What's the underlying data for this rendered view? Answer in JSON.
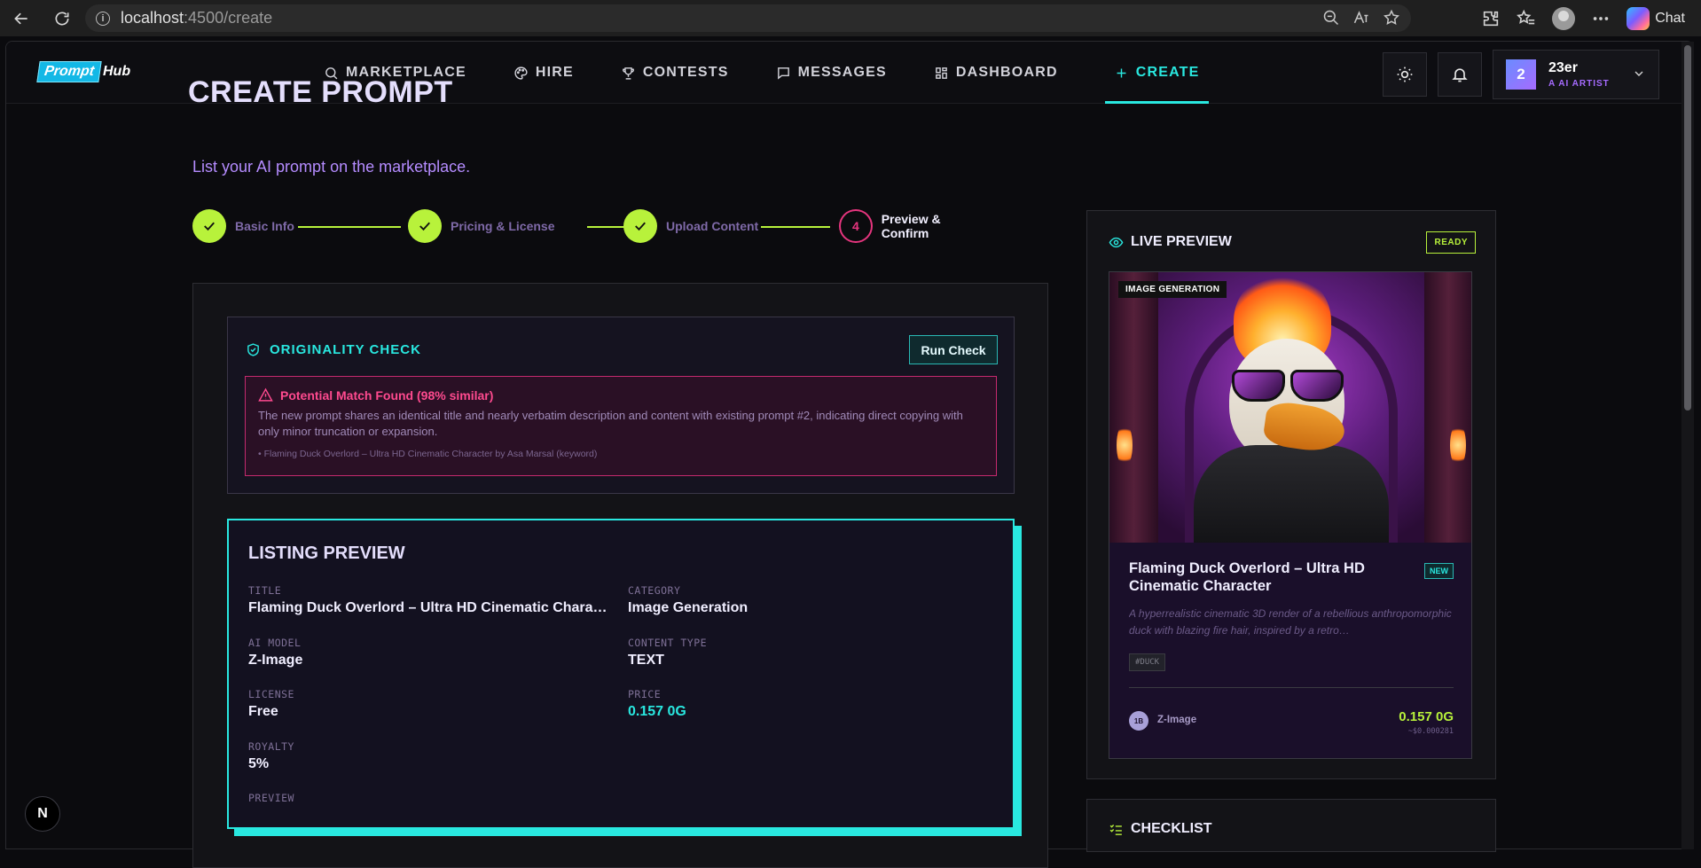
{
  "browser": {
    "url_host": "localhost",
    "url_rest": ":4500/create",
    "chat_label": "Chat"
  },
  "app": {
    "brand_box": "Prompt",
    "brand_rest": "Hub",
    "nav": [
      {
        "label": "MARKETPLACE",
        "icon": "search-icon"
      },
      {
        "label": "HIRE",
        "icon": "palette-icon"
      },
      {
        "label": "CONTESTS",
        "icon": "trophy-icon"
      },
      {
        "label": "MESSAGES",
        "icon": "message-icon"
      },
      {
        "label": "DASHBOARD",
        "icon": "grid-icon"
      },
      {
        "label": "CREATE",
        "icon": "plus-icon",
        "active": true
      }
    ],
    "user": {
      "avatar": "2",
      "name": "23er",
      "role": "A AI ARTIST"
    }
  },
  "page": {
    "title": "CREATE PROMPT",
    "subtitle": "List your AI prompt on the marketplace.",
    "steps": [
      {
        "label": "Basic Info",
        "state": "done"
      },
      {
        "label": "Pricing & License",
        "state": "done"
      },
      {
        "label": "Upload Content",
        "state": "done"
      },
      {
        "label": "Preview & Confirm",
        "state": "current",
        "number": "4"
      }
    ]
  },
  "originality": {
    "heading": "ORIGINALITY CHECK",
    "button": "Run Check",
    "match_title": "Potential Match Found (98% similar)",
    "match_text": "The new prompt shares an identical title and nearly verbatim description and content with existing prompt #2, indicating direct copying with only minor truncation or expansion.",
    "match_ref": "• Flaming Duck Overlord – Ultra HD Cinematic Character by Asa Marsal (keyword)"
  },
  "listing": {
    "heading": "LISTING PREVIEW",
    "fields": {
      "title_key": "TITLE",
      "title_val": "Flaming Duck Overlord – Ultra HD Cinematic Character",
      "category_key": "CATEGORY",
      "category_val": "Image Generation",
      "model_key": "AI MODEL",
      "model_val": "Z-Image",
      "ctype_key": "CONTENT TYPE",
      "ctype_val": "TEXT",
      "license_key": "LICENSE",
      "license_val": "Free",
      "price_key": "PRICE",
      "price_val": "0.157 0G",
      "royalty_key": "ROYALTY",
      "royalty_val": "5%",
      "preview_key": "PREVIEW"
    }
  },
  "live_preview": {
    "heading": "LIVE PREVIEW",
    "status": "READY",
    "card": {
      "badge": "IMAGE GENERATION",
      "title": "Flaming Duck Overlord – Ultra HD Cinematic Character",
      "new_badge": "NEW",
      "description": "A hyperrealistic cinematic 3D render of a rebellious anthropomorphic duck with blazing fire hair, inspired by a retro…",
      "tag": "#DUCK",
      "mini_avatar": "1B",
      "model": "Z-Image",
      "price": "0.157 0G",
      "usd": "~$0.000281"
    }
  },
  "checklist": {
    "heading": "CHECKLIST"
  },
  "dev_badge": "N",
  "colors": {
    "accent_cyan": "#29e8e0",
    "accent_lime": "#b8f23b",
    "accent_pink": "#e6357e",
    "accent_purple": "#b58cff"
  }
}
